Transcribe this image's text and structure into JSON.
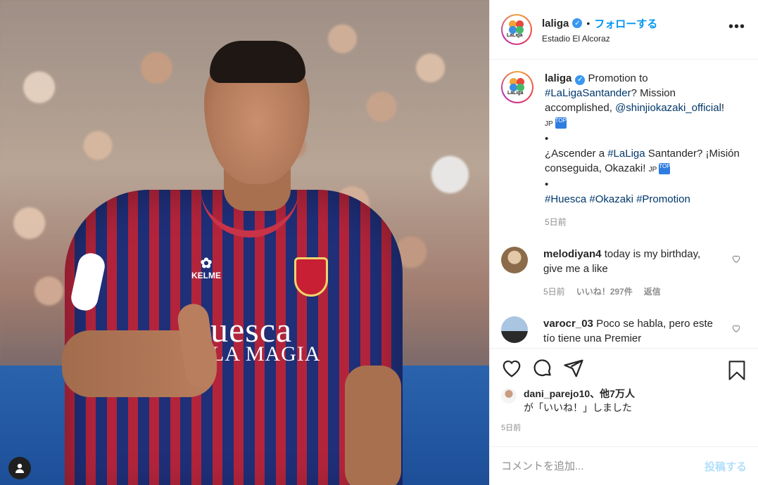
{
  "post": {
    "username": "laliga",
    "follow_label": "フォローする",
    "separator": "•",
    "location": "Estadio El Alcoraz",
    "more_label": "•••",
    "avatar_text": "LaLiga"
  },
  "photo": {
    "shirt_line1": "Huesca",
    "shirt_line2": "LA MAGIA",
    "brand": "KELME"
  },
  "caption": {
    "username": "laliga",
    "text_en_a": "Promotion to ",
    "tag_laliga_santander": "#LaLigaSantander",
    "text_en_b": "? Mission accomplished, ",
    "mention": "@shinjiokazaki_official",
    "text_en_c": "!",
    "jp_letter": "JP",
    "jp_box": "TOP",
    "bullet": "•",
    "text_es_a": "¿Ascender a ",
    "tag_laliga": "#LaLiga",
    "text_es_b": " Santander? ¡Misión conseguida, Okazaki! ",
    "tag_huesca": "#Huesca",
    "tag_okazaki": "#Okazaki",
    "tag_promotion": "#Promotion",
    "time": "5日前"
  },
  "comments": [
    {
      "username": "melodiyan4",
      "text": "today is my birthday, give me a like",
      "time": "5日前",
      "likes": "いいね！297件",
      "reply": "返信"
    },
    {
      "username": "varocr_03",
      "text": "Poco se habla, pero este tío tiene una Premier"
    }
  ],
  "actions": {
    "liked_by_user": "dani_parejo10",
    "liked_by_others": "、他7万人",
    "liked_suffix": "が「いいね！」しました",
    "time": "5日前"
  },
  "add_comment": {
    "placeholder": "コメントを追加...",
    "post_label": "投稿する"
  },
  "colors": {
    "link_blue": "#0095f6",
    "hashtag": "#00376b",
    "muted": "#8e8e8e"
  }
}
